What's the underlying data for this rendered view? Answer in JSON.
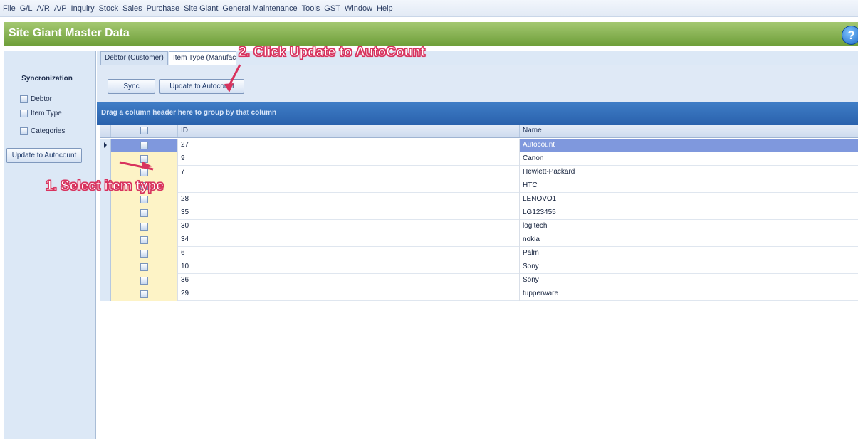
{
  "menu": [
    "File",
    "G/L",
    "A/R",
    "A/P",
    "Inquiry",
    "Stock",
    "Sales",
    "Purchase",
    "Site Giant",
    "General Maintenance",
    "Tools",
    "GST",
    "Window",
    "Help"
  ],
  "window": {
    "title": "Site Giant Master Data",
    "help_glyph": "?"
  },
  "sidebar": {
    "section_label": "Syncronization",
    "items": [
      {
        "label": "Debtor",
        "checked": false
      },
      {
        "label": "Item Type",
        "checked": false
      },
      {
        "label": "Categories",
        "checked": false
      }
    ],
    "update_button": "Update to Autocount"
  },
  "tabs": [
    {
      "label": "Debtor (Customer)",
      "active": false
    },
    {
      "label": "Item Type (Manufacturer)",
      "active": true
    }
  ],
  "toolbar": {
    "sync_label": "Sync",
    "update_label": "Update to Autocount"
  },
  "grid": {
    "group_hint": "Drag a column header here to group by that column",
    "columns": [
      "",
      "ID",
      "Name"
    ],
    "rows": [
      {
        "id": "27",
        "name": "Autocount",
        "selected": true
      },
      {
        "id": "9",
        "name": "Canon"
      },
      {
        "id": "7",
        "name": "Hewlett-Packard"
      },
      {
        "id": "",
        "name": "HTC"
      },
      {
        "id": "28",
        "name": "LENOVO1"
      },
      {
        "id": "35",
        "name": "LG123455"
      },
      {
        "id": "30",
        "name": "logitech"
      },
      {
        "id": "34",
        "name": "nokia"
      },
      {
        "id": "6",
        "name": "Palm"
      },
      {
        "id": "10",
        "name": "Sony"
      },
      {
        "id": "36",
        "name": "Sony"
      },
      {
        "id": "29",
        "name": "tupperware"
      }
    ]
  },
  "annotations": {
    "step1": "1. Select item type",
    "step2": "2. Click Update to AutoCount",
    "color": "#d8335e"
  }
}
